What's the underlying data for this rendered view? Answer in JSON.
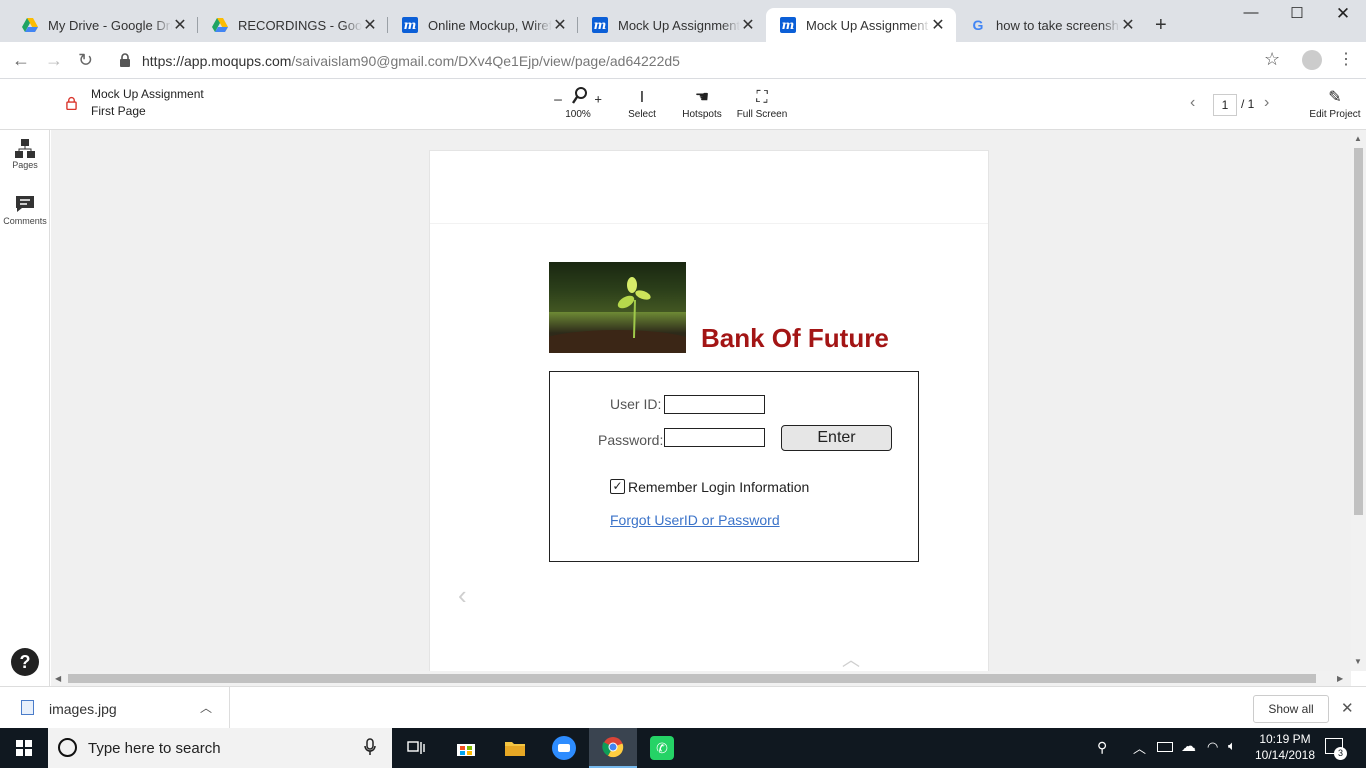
{
  "browser": {
    "tabs": [
      {
        "title": "My Drive - Google Drive",
        "icon": "google-drive-icon",
        "active": false
      },
      {
        "title": "RECORDINGS - Google Drive",
        "icon": "google-drive-icon",
        "active": false
      },
      {
        "title": "Online Mockup, Wireframe",
        "icon": "moqups-icon",
        "active": false
      },
      {
        "title": "Mock Up Assignment - Moqups",
        "icon": "moqups-icon",
        "active": false
      },
      {
        "title": "Mock Up Assignment - Moqups",
        "icon": "moqups-icon",
        "active": true
      },
      {
        "title": "how to take screenshot",
        "icon": "google-icon",
        "active": false
      }
    ],
    "url_host": "https://app.moqups.com",
    "url_path": "/saivaislam90@gmail.com/DXv4Qe1Ejp/view/page/ad64222d5"
  },
  "app": {
    "logo": "m",
    "project_name": "Mock Up Assignment",
    "page_name": "First Page",
    "zoom": "100%",
    "tools": {
      "select": "Select",
      "hotspots": "Hotspots",
      "fullscreen": "Full Screen"
    },
    "page_current": "1",
    "page_total": "/ 1",
    "edit_label": "Edit Project",
    "sidebar": {
      "pages": "Pages",
      "comments": "Comments"
    },
    "help": "?"
  },
  "mockup": {
    "bank_title": "Bank Of Future",
    "userid_label": "User ID:",
    "password_label": "Password:",
    "enter_label": "Enter",
    "remember_label": "Remember Login Information",
    "remember_checked": true,
    "forgot_link": "Forgot UserID or Password"
  },
  "downloads": {
    "file": "images.jpg",
    "show_all": "Show all"
  },
  "taskbar": {
    "search_placeholder": "Type here to search",
    "time": "10:19 PM",
    "date": "10/14/2018",
    "notifications": "3"
  },
  "colors": {
    "brand": "#0b5fd7",
    "bank_title": "#a31515",
    "link": "#3b73c9",
    "form_label": "#555555"
  }
}
